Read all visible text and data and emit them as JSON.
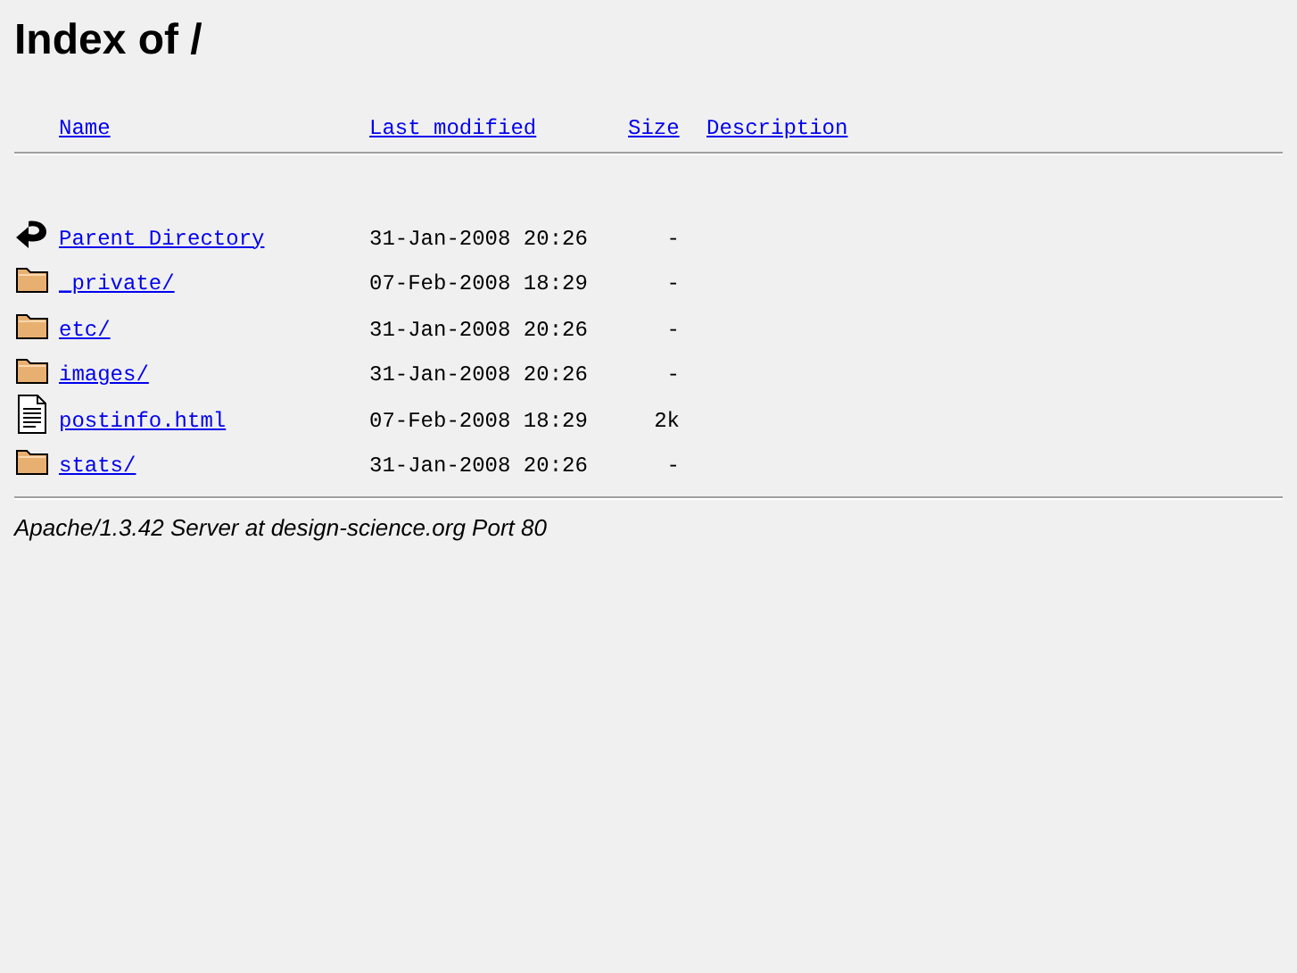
{
  "title": "Index of /",
  "columns": [
    "Name",
    "Last modified",
    "Size",
    "Description"
  ],
  "entries": [
    {
      "kind": "back",
      "name": "Parent Directory",
      "modified": "31-Jan-2008 20:26",
      "size": "-"
    },
    {
      "kind": "folder",
      "name": "_private/",
      "modified": "07-Feb-2008 18:29",
      "size": "-"
    },
    {
      "kind": "folder",
      "name": "etc/",
      "modified": "31-Jan-2008 20:26",
      "size": "-"
    },
    {
      "kind": "folder",
      "name": "images/",
      "modified": "31-Jan-2008 20:26",
      "size": "-"
    },
    {
      "kind": "file",
      "name": "postinfo.html",
      "modified": "07-Feb-2008 18:29",
      "size": "2k"
    },
    {
      "kind": "folder",
      "name": "stats/",
      "modified": "31-Jan-2008 20:26",
      "size": "-"
    }
  ],
  "footer": "Apache/1.3.42 Server at design-science.org Port 80"
}
